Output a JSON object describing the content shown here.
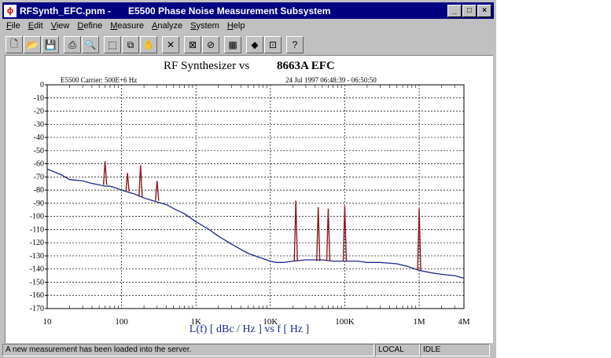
{
  "window": {
    "title_file": "RFSynth_EFC.pnm -",
    "title_app": "E5500 Phase Noise Measurement Subsystem",
    "controls": [
      "_",
      "□",
      "×"
    ]
  },
  "menu": [
    "File",
    "Edit",
    "View",
    "Define",
    "Measure",
    "Analyze",
    "System",
    "Help"
  ],
  "toolbar": {
    "buttons": [
      {
        "name": "new-file-icon",
        "glyph": "🗋"
      },
      {
        "name": "open-folder-icon",
        "glyph": "📂"
      },
      {
        "name": "save-disk-icon",
        "glyph": "💾"
      },
      {
        "name": "print-icon",
        "glyph": "⎙"
      },
      {
        "name": "print-preview-icon",
        "glyph": "🔍"
      },
      {
        "name": "zoom-box-icon",
        "glyph": "⬚"
      },
      {
        "name": "copy-windows-icon",
        "glyph": "⧉"
      },
      {
        "name": "hand-pan-icon",
        "glyph": "✋"
      },
      {
        "name": "delete-x-icon",
        "glyph": "✕"
      },
      {
        "name": "marker-icon",
        "glyph": "⊠"
      },
      {
        "name": "spur-edit-icon",
        "glyph": "⊘"
      },
      {
        "name": "table-icon",
        "glyph": "▦"
      },
      {
        "name": "diamond-icon",
        "glyph": "◆"
      },
      {
        "name": "graph-window-icon",
        "glyph": "⊡"
      },
      {
        "name": "help-pointer-icon",
        "glyph": "?"
      }
    ]
  },
  "chart_data": {
    "type": "line",
    "title_left": "RF Synthesizer vs",
    "title_right": "8663A EFC",
    "subtitle_left": "E5500   Carrier: 500E+6 Hz",
    "subtitle_right": "24 Jul 1997   06:48:39 - 06:50:50",
    "xlabel": "L(f)  [ dBc / Hz ]  vs  f  [ Hz ]",
    "xscale": "log",
    "xlim": [
      10,
      4000000
    ],
    "ylim": [
      -170,
      0
    ],
    "x_ticks": [
      {
        "value": 10,
        "label": "10"
      },
      {
        "value": 100,
        "label": "100"
      },
      {
        "value": 1000,
        "label": "1K"
      },
      {
        "value": 10000,
        "label": "10K"
      },
      {
        "value": 100000,
        "label": "100K"
      },
      {
        "value": 1000000,
        "label": "1M"
      },
      {
        "value": 4000000,
        "label": "4M"
      }
    ],
    "y_ticks": [
      "0",
      "-10",
      "-20",
      "-30",
      "-40",
      "-50",
      "-60",
      "-70",
      "-80",
      "-90",
      "-100",
      "-110",
      "-120",
      "-130",
      "-140",
      "-150",
      "-160",
      "-170"
    ],
    "grid": true,
    "series": [
      {
        "name": "",
        "color": "#1a2a8a",
        "x": [
          10,
          15,
          20,
          30,
          40,
          50,
          60,
          70,
          80,
          100,
          130,
          150,
          200,
          300,
          400,
          500,
          700,
          1000,
          1500,
          2000,
          3000,
          4000,
          5000,
          7000,
          10000,
          12000,
          15000,
          20000,
          30000,
          50000,
          70000,
          100000,
          150000,
          200000,
          300000,
          500000,
          700000,
          1000000,
          1500000,
          2000000,
          3000000,
          4000000
        ],
        "y": [
          -64,
          -68,
          -72,
          -73,
          -75,
          -76,
          -77,
          -77,
          -78,
          -80,
          -82,
          -83,
          -86,
          -89,
          -91,
          -94,
          -98,
          -104,
          -110,
          -115,
          -121,
          -125,
          -128,
          -131,
          -134,
          -135,
          -135,
          -134,
          -133,
          -133,
          -134,
          -134,
          -134,
          -135,
          -135,
          -136,
          -138,
          -141,
          -143,
          -144,
          -145,
          -147
        ]
      }
    ],
    "spurs": [
      {
        "x": 60,
        "y": -58,
        "base": -76,
        "color": "#8b1a1a"
      },
      {
        "x": 120,
        "y": -67,
        "base": -81,
        "color": "#8b1a1a"
      },
      {
        "x": 180,
        "y": -61,
        "base": -85,
        "color": "#8b1a1a"
      },
      {
        "x": 300,
        "y": -73,
        "base": -88,
        "color": "#8b1a1a"
      },
      {
        "x": 22000,
        "y": -88,
        "base": -134,
        "color": "#8b1a1a"
      },
      {
        "x": 44000,
        "y": -93,
        "base": -134,
        "color": "#8b1a1a"
      },
      {
        "x": 60000,
        "y": -94,
        "base": -134,
        "color": "#8b1a1a"
      },
      {
        "x": 100000,
        "y": -92,
        "base": -134,
        "color": "#8b1a1a"
      },
      {
        "x": 1000000,
        "y": -94,
        "base": -141,
        "color": "#8b1a1a"
      }
    ]
  },
  "status": {
    "message": "A new measurement has been loaded into the server.",
    "mode": "LOCAL",
    "state": "IDLE"
  }
}
